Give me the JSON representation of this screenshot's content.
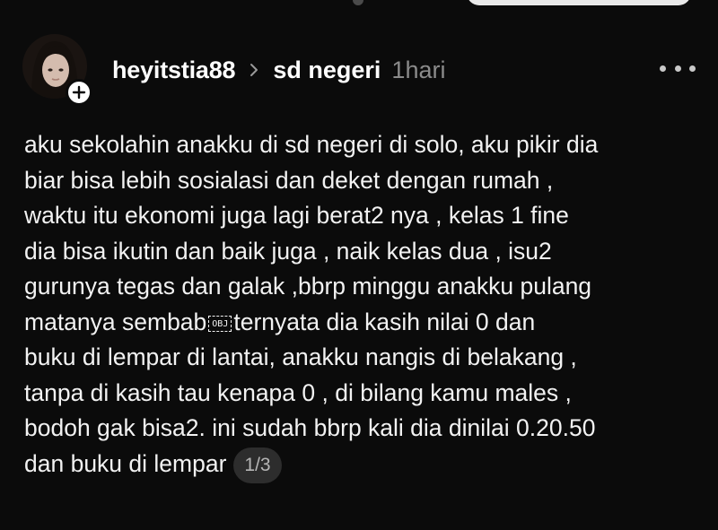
{
  "post": {
    "username": "heyitstia88",
    "community": "sd negeri",
    "time": "1hari",
    "lines": [
      "aku sekolahin anakku di sd negeri di solo, aku pikir dia",
      "biar bisa lebih sosialasi dan deket dengan rumah ,",
      "waktu itu ekonomi juga lagi berat2 nya , kelas 1 fine",
      "dia bisa ikutin dan baik juga , naik kelas dua , isu2",
      "gurunya tegas dan galak ,bbrp minggu anakku pulang",
      "matanya sembab",
      "ternyata dia kasih nilai 0 dan",
      "buku di lempar di lantai, anakku nangis di belakang ,",
      "tanpa di kasih tau kenapa 0 , di bilang kamu males ,",
      "bodoh gak bisa2. ini sudah bbrp kali dia dinilai 0.20.50",
      "dan buku di lempar"
    ],
    "obj_glyph": "OBJ",
    "pager": "1/3"
  },
  "icons": {
    "follow": "plus-icon",
    "separator": "chevron-right-icon",
    "menu": "more-horizontal-icon"
  },
  "colors": {
    "background": "#0b0b0b",
    "text": "#f2f2f2",
    "muted": "#8b8b8b",
    "pager_bg": "#2d2d2d"
  }
}
